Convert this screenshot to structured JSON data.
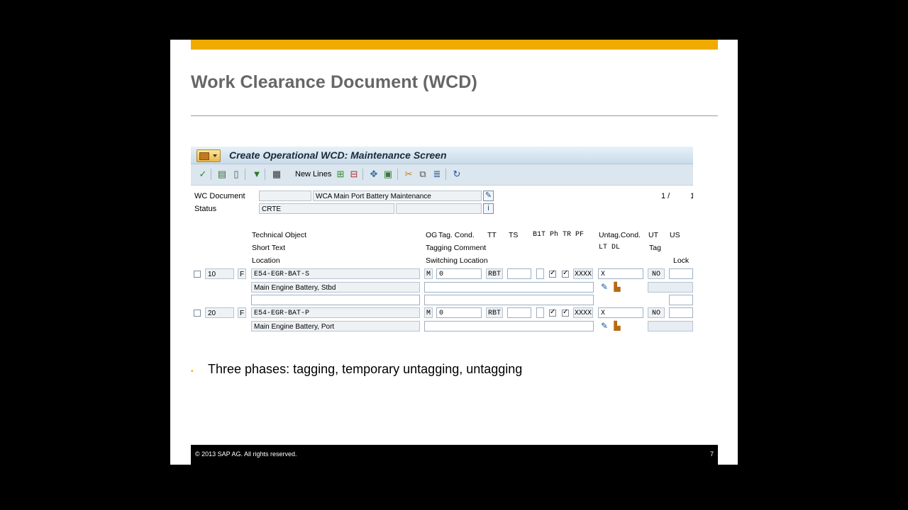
{
  "slide": {
    "title": "Work Clearance Document (WCD)",
    "bullet": "Three phases: tagging, temporary untagging, untagging",
    "footer_copyright": "©  2013 SAP AG. All rights reserved.",
    "page_number": "7",
    "accent_color": "#f0ab00"
  },
  "window": {
    "title": "Create Operational WCD: Maintenance Screen"
  },
  "toolbar": {
    "new_lines_label": "New Lines",
    "icons": [
      "check-icon",
      "copy-doc-icon",
      "doc-icon",
      "filter-icon",
      "columns-icon",
      "insert-row-icon",
      "delete-row-icon",
      "move-icon",
      "refresh-doc-icon",
      "cut-icon",
      "copy-icon",
      "align-icon",
      "undo-icon"
    ]
  },
  "header": {
    "wc_document_label": "WC Document",
    "wc_document_number": "",
    "wc_document_text": "WCA Main Port Battery Maintenance",
    "status_label": "Status",
    "status_value": "CRTE",
    "status_extra": "",
    "page_info": "1 /",
    "page_total": "1"
  },
  "columns": {
    "technical_object": "Technical Object",
    "short_text": "Short Text",
    "location": "Location",
    "og": "OG",
    "tag_cond": "Tag. Cond.",
    "tt": "TT",
    "ts": "TS",
    "b1t_ph_tr_pf": "B1T Ph TR PF",
    "tagging_comment": "Tagging Comment",
    "switching_location": "Switching Location",
    "untag_cond": "Untag.Cond.",
    "ut": "UT",
    "us": "US",
    "lt_dl": "LT DL",
    "tag": "Tag",
    "lock": "Lock"
  },
  "rows": [
    {
      "item": "10",
      "flag": "F",
      "technical_object": "E54-EGR-BAT-S",
      "short_text": "Main Engine Battery, Stbd",
      "location": "",
      "og": "M",
      "tag_cond": "0",
      "tt": "RBT",
      "ts": "",
      "b1t": "",
      "ph": true,
      "tr": true,
      "pf": "XXXX",
      "tagging_comment": "",
      "switching_location": "",
      "untag_cond": "X",
      "ut": "NO",
      "us": "",
      "lock": ""
    },
    {
      "item": "20",
      "flag": "F",
      "technical_object": "E54-EGR-BAT-P",
      "short_text": "Main Engine Battery, Port",
      "og": "M",
      "tag_cond": "0",
      "tt": "RBT",
      "ts": "",
      "b1t": "",
      "ph": true,
      "tr": true,
      "pf": "XXXX",
      "tagging_comment": "",
      "untag_cond": "X",
      "ut": "NO",
      "us": ""
    }
  ]
}
